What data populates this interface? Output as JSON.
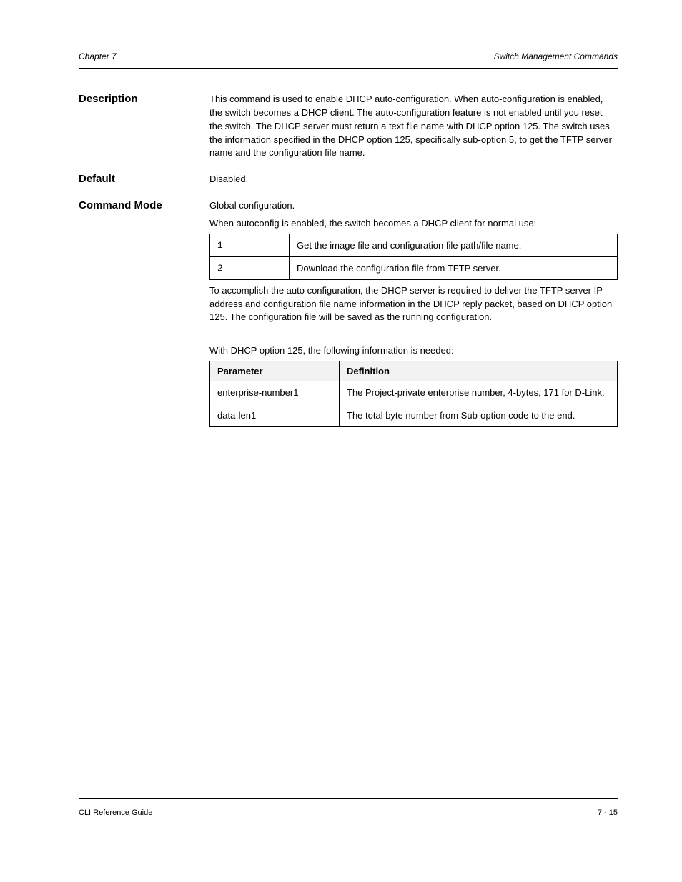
{
  "header": {
    "left": "Chapter 7",
    "right": "Switch Management Commands"
  },
  "footer": {
    "left": "CLI Reference Guide",
    "right": "7 - 15"
  },
  "sections": {
    "description": {
      "heading": "Description",
      "text": "This command is used to enable DHCP auto-configuration. When auto-configuration is enabled, the switch becomes a DHCP client. The auto-configuration feature is not enabled until you reset the switch. The DHCP server must return a text file name with DHCP option 125. The switch uses the information specified in the DHCP option 125, specifically sub-option 5, to get the TFTP server name and the configuration file name."
    },
    "default": {
      "heading": "Default",
      "text": "Disabled."
    },
    "command_mode": {
      "heading": "Command Mode",
      "text": "Global configuration."
    },
    "t1_intro": "When autoconfig is enabled, the switch becomes a DHCP client for normal use:",
    "table1": {
      "rows": [
        {
          "c0": "1",
          "c1": "Get the image file and configuration file path/file name."
        },
        {
          "c0": "2",
          "c1": "Download the configuration file from TFTP server."
        }
      ]
    },
    "t1_after": "To accomplish the auto configuration, the DHCP server is required to deliver the TFTP server IP address and configuration file name information in the DHCP reply packet, based on DHCP option 125. The configuration file will be saved as the running configuration.",
    "dhcp_opt": {
      "intro": "With DHCP option 125, the following information is needed:",
      "th0": "Parameter",
      "th1": "Definition",
      "rows": [
        {
          "p": "enterprise-number1",
          "d": "The Project-private enterprise number, 4-bytes, 171 for D-Link."
        },
        {
          "p": "data-len1",
          "d": "The total byte number from Sub-option code to the end."
        }
      ]
    }
  }
}
